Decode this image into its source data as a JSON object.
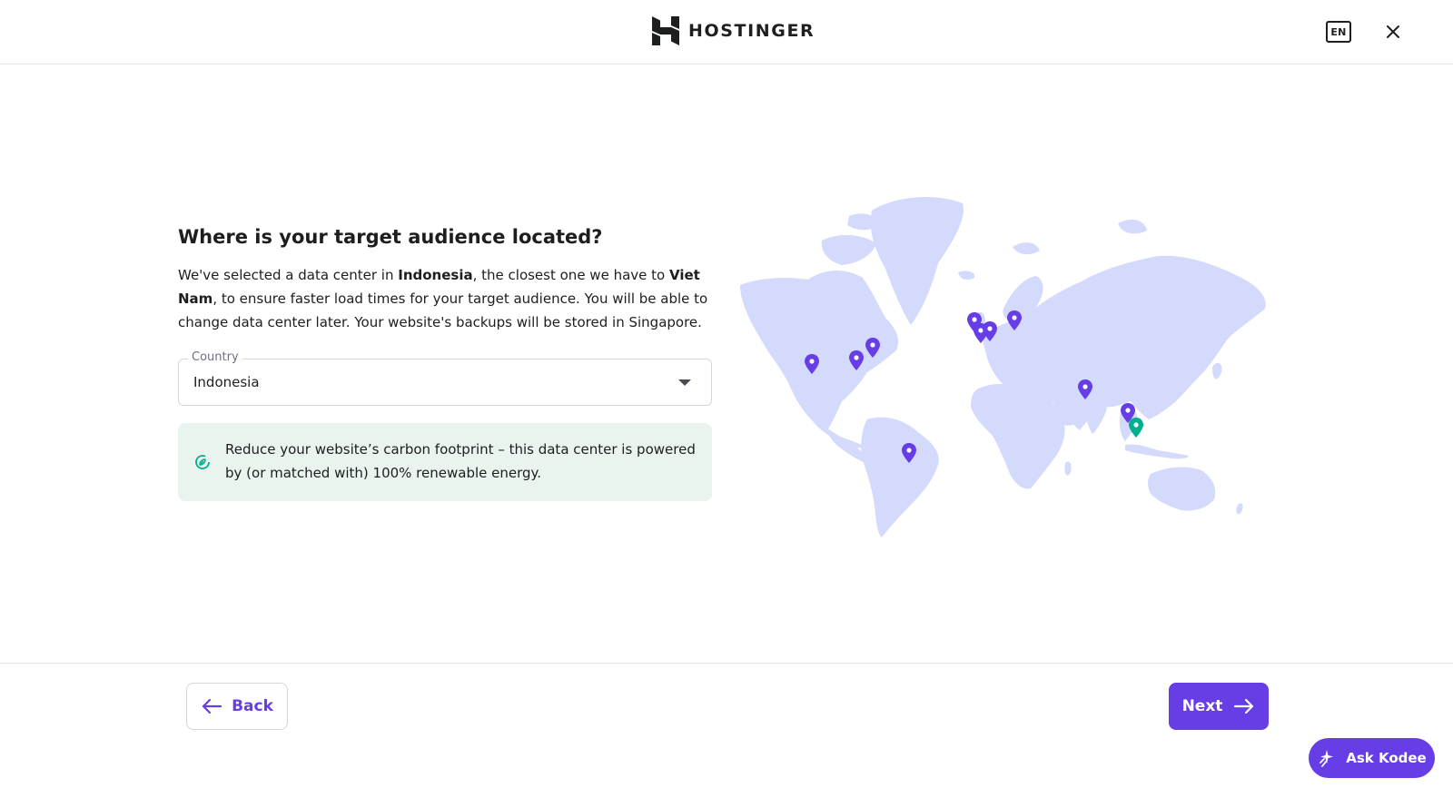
{
  "header": {
    "brand": "HOSTINGER",
    "language": "EN"
  },
  "main": {
    "heading": "Where is your target audience located?",
    "description": {
      "part1": "We've selected a data center in ",
      "datacenter": "Indonesia",
      "part2": ", the closest one we have to ",
      "location": "Viet Nam",
      "part3": ", to ensure faster load times for your target audience. You will be able to change data center later. Your website's backups will be stored in Singapore."
    },
    "country_select": {
      "label": "Country",
      "value": "Indonesia"
    },
    "eco_notice": "Reduce your website’s carbon footprint – this data center is powered by (or matched with) 100% renewable energy."
  },
  "map": {
    "land_color": "#d3dafc",
    "pin_color": "#673de6",
    "selected_pin_color": "#00b090"
  },
  "footer": {
    "back_label": "Back",
    "next_label": "Next",
    "assistant_label": "Ask Kodee"
  },
  "colors": {
    "accent": "#673de6",
    "eco_background": "#e9f4ee",
    "eco_icon": "#00b090"
  }
}
